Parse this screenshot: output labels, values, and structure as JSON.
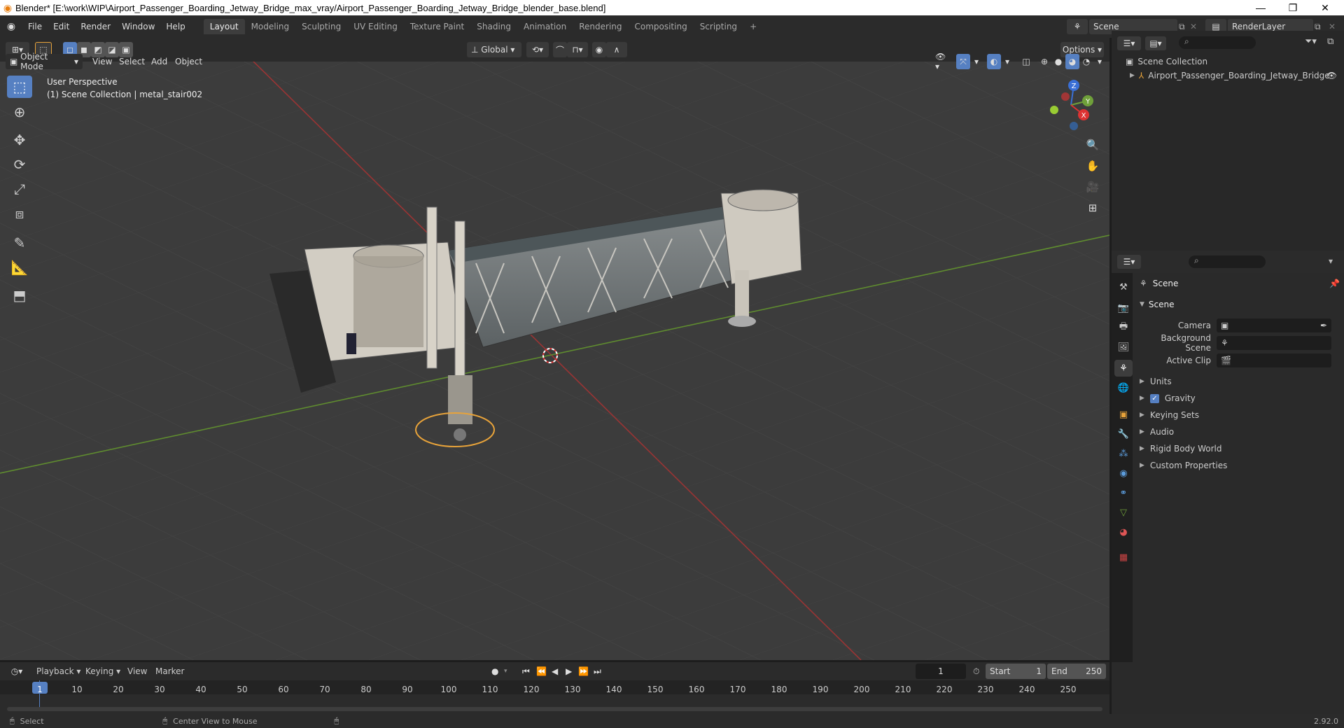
{
  "window": {
    "title": "Blender* [E:\\work\\WIP\\Airport_Passenger_Boarding_Jetway_Bridge_max_vray/Airport_Passenger_Boarding_Jetway_Bridge_blender_base.blend]",
    "minimize": "—",
    "restore": "❐",
    "close": "✕"
  },
  "menu": [
    "File",
    "Edit",
    "Render",
    "Window",
    "Help"
  ],
  "workspaces": [
    "Layout",
    "Modeling",
    "Sculpting",
    "UV Editing",
    "Texture Paint",
    "Shading",
    "Animation",
    "Rendering",
    "Compositing",
    "Scripting"
  ],
  "workspace_add": "+",
  "scene_field": "Scene",
  "renderlayer_field": "RenderLayer",
  "viewport_header": {
    "transform_orientation": "Global",
    "options": "Options"
  },
  "viewport_mode": {
    "mode": "Object Mode",
    "menus": [
      "View",
      "Select",
      "Add",
      "Object"
    ]
  },
  "viewport_info": {
    "perspective": "User Perspective",
    "collection": "(1) Scene Collection | metal_stair002"
  },
  "gizmo": {
    "z": "Z",
    "y": "Y",
    "x": "X"
  },
  "outliner": {
    "root": "Scene Collection",
    "items": [
      {
        "label": "Airport_Passenger_Boarding_Jetway_Bridge"
      }
    ]
  },
  "properties": {
    "context": "Scene",
    "panel": "Scene",
    "fields": [
      {
        "label": "Camera",
        "value": ""
      },
      {
        "label": "Background Scene",
        "value": ""
      },
      {
        "label": "Active Clip",
        "value": ""
      }
    ],
    "sections": [
      "Units",
      "Gravity",
      "Keying Sets",
      "Audio",
      "Rigid Body World",
      "Custom Properties"
    ],
    "gravity_checked": true
  },
  "timeline": {
    "menus": [
      "Playback",
      "Keying",
      "View",
      "Marker"
    ],
    "current_frame": "1",
    "start_label": "Start",
    "start": "1",
    "end_label": "End",
    "end": "250",
    "ticks": [
      "1",
      "10",
      "20",
      "30",
      "40",
      "50",
      "60",
      "70",
      "80",
      "90",
      "100",
      "110",
      "120",
      "130",
      "140",
      "150",
      "160",
      "170",
      "180",
      "190",
      "200",
      "210",
      "220",
      "230",
      "240",
      "250"
    ]
  },
  "statusbar": {
    "select": "Select",
    "center_view": "Center View to Mouse",
    "version": "2.92.0"
  },
  "colors": {
    "accent": "#5680c2",
    "x_axis": "#c23b3b",
    "y_axis": "#6fa03a",
    "selection": "#e8a33a"
  }
}
